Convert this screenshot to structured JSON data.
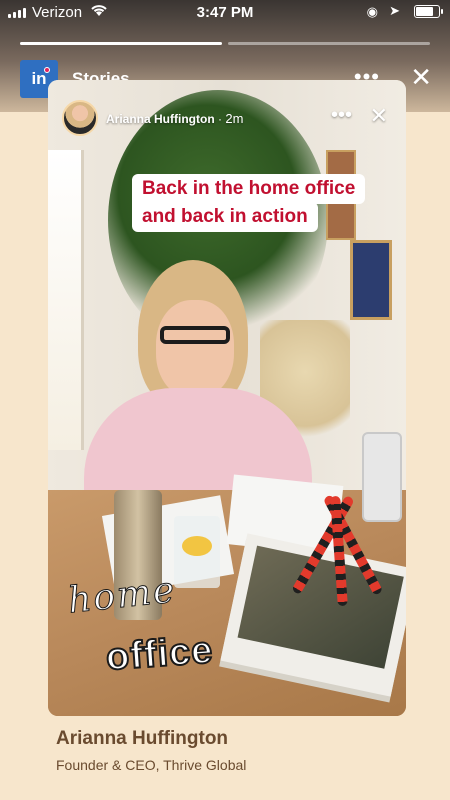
{
  "status_bar": {
    "carrier": "Verizon",
    "time": "3:47 PM"
  },
  "progress": {
    "segments": [
      1.0,
      0.0
    ]
  },
  "header": {
    "title": "Stories",
    "logo_text": "in"
  },
  "story": {
    "author": "Arianna Huffington",
    "separator": "·",
    "age": "2m",
    "caption_lines": [
      "Back in the home office",
      "and back in action"
    ],
    "sticker_script": "home",
    "sticker_bubble": "office"
  },
  "footer": {
    "name": "Arianna Huffington",
    "role": "Founder & CEO, Thrive Global"
  },
  "colors": {
    "linkedin_blue": "#2f6fc1",
    "caption_red": "#c11030",
    "footer_text": "#6a4b2f",
    "background": "#f7e6cc"
  }
}
